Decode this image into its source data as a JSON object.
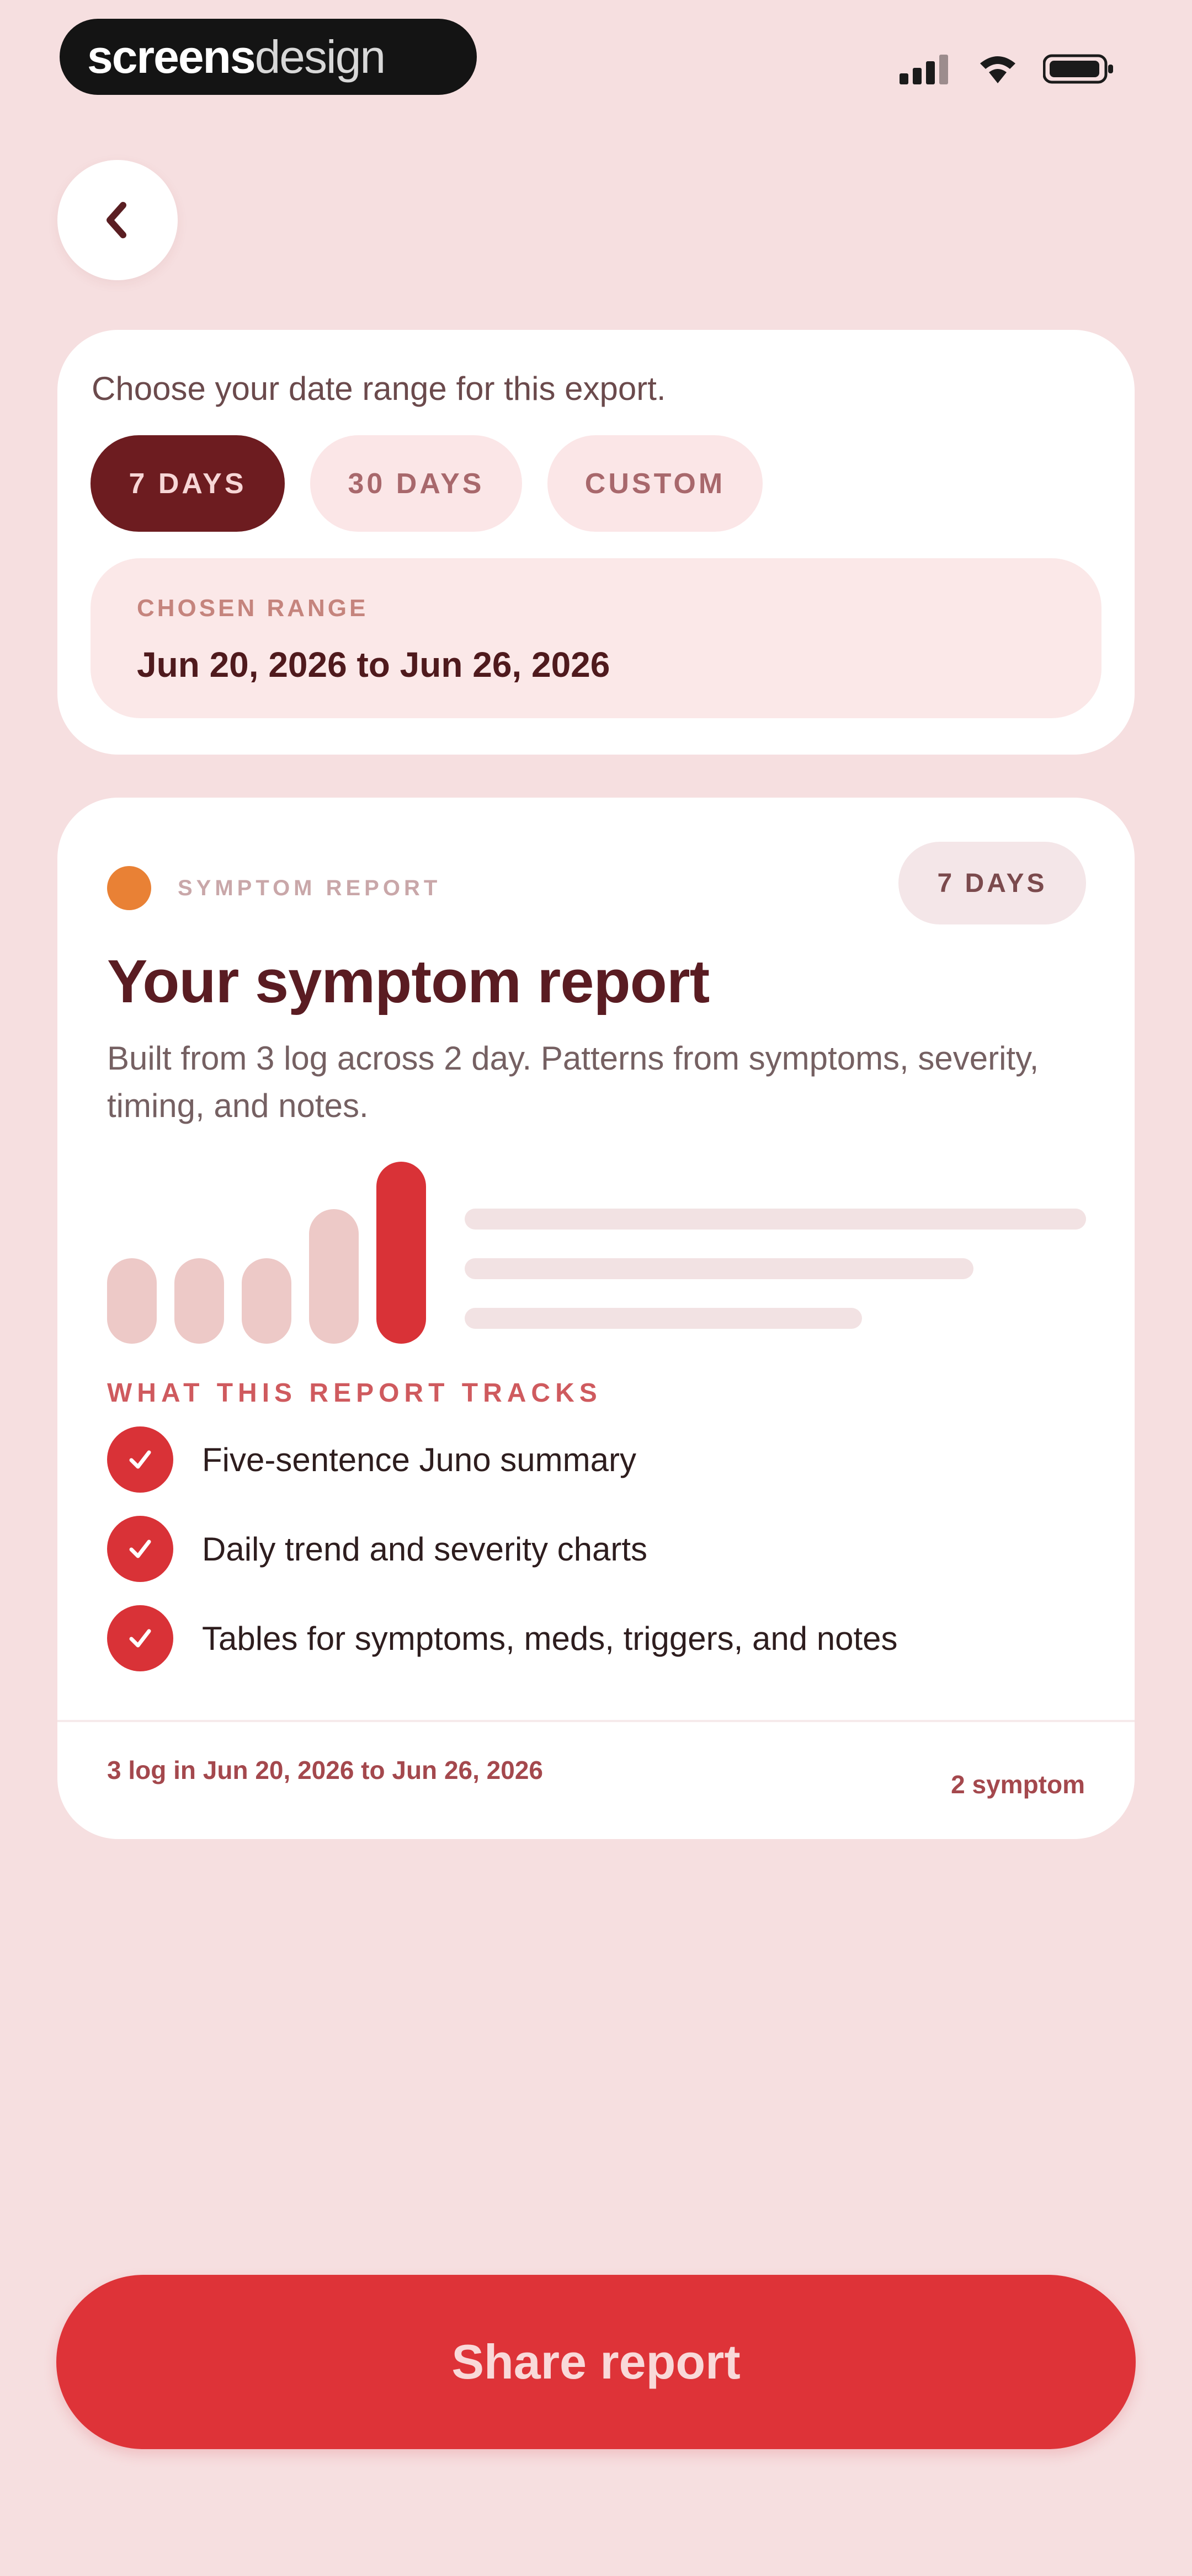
{
  "status_bar": {
    "brand_bold": "screens",
    "brand_thin": "design",
    "icons": [
      "signal-icon",
      "wifi-icon",
      "battery-icon"
    ]
  },
  "nav": {
    "back_icon": "chevron-left-icon"
  },
  "date_range": {
    "prompt": "Choose your date range for this export.",
    "options": [
      {
        "label": "7 DAYS",
        "selected": true
      },
      {
        "label": "30 DAYS",
        "selected": false
      },
      {
        "label": "CUSTOM",
        "selected": false
      }
    ],
    "chosen_label": "CHOSEN RANGE",
    "chosen_value": "Jun 20, 2026 to Jun 26, 2026"
  },
  "report": {
    "kicker": "SYMPTOM REPORT",
    "period_badge": "7 DAYS",
    "title": "Your symptom report",
    "description": "Built from 3 log across 2 day. Patterns from symptoms, severity, timing, and notes.",
    "preview_bar_levels": [
      0.47,
      0.47,
      0.47,
      0.74,
      1.0
    ],
    "tracks_heading": "WHAT THIS REPORT TRACKS",
    "tracks": [
      "Five-sentence Juno summary",
      "Daily trend and severity charts",
      "Tables for symptoms, meds, triggers, and notes"
    ],
    "footer_left": "3 log in Jun 20, 2026 to Jun 26, 2026",
    "footer_right": "2 symptom"
  },
  "actions": {
    "share_label": "Share report"
  },
  "colors": {
    "background": "#f6dfe0",
    "accent_red": "#de3338",
    "selected_chip": "#6d1c20",
    "dot_orange": "#e98135",
    "bar_light": "#edc9c7",
    "bar_active": "#d93237"
  }
}
